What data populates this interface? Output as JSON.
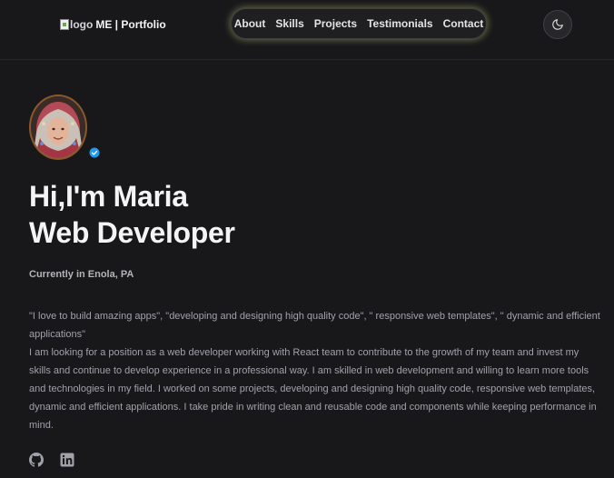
{
  "header": {
    "logo_alt": "logo",
    "logo_text": "ME | Portfolio",
    "nav": [
      "About",
      "Skills",
      "Projects",
      "Testimonials",
      "Contact"
    ],
    "theme_icon": "moon-icon"
  },
  "hero": {
    "greeting": "Hi,I'm Maria",
    "role": "Web Developer",
    "location": "Currently in Enola, PA",
    "quote": "\"I love to build amazing apps\", \"developing and designing high quality code\", \" responsive web templates\", \" dynamic and efficient applications\"",
    "bio": "I am looking for a position as a web developer working with React team to contribute to the growth of my team and invest my skills and continue to develop experience in a professional way. I am skilled in web development and willing to learn more tools and technologies in my field. I worked on some projects, developing and designing high quality code, responsive web templates, dynamic and efficient applications. I take pride in writing clean and reusable code and components while keeping performance in mind.",
    "badge_icon": "verified-check-icon",
    "badge_color": "#1d9bf0"
  },
  "socials": [
    "github-icon",
    "linkedin-icon"
  ]
}
